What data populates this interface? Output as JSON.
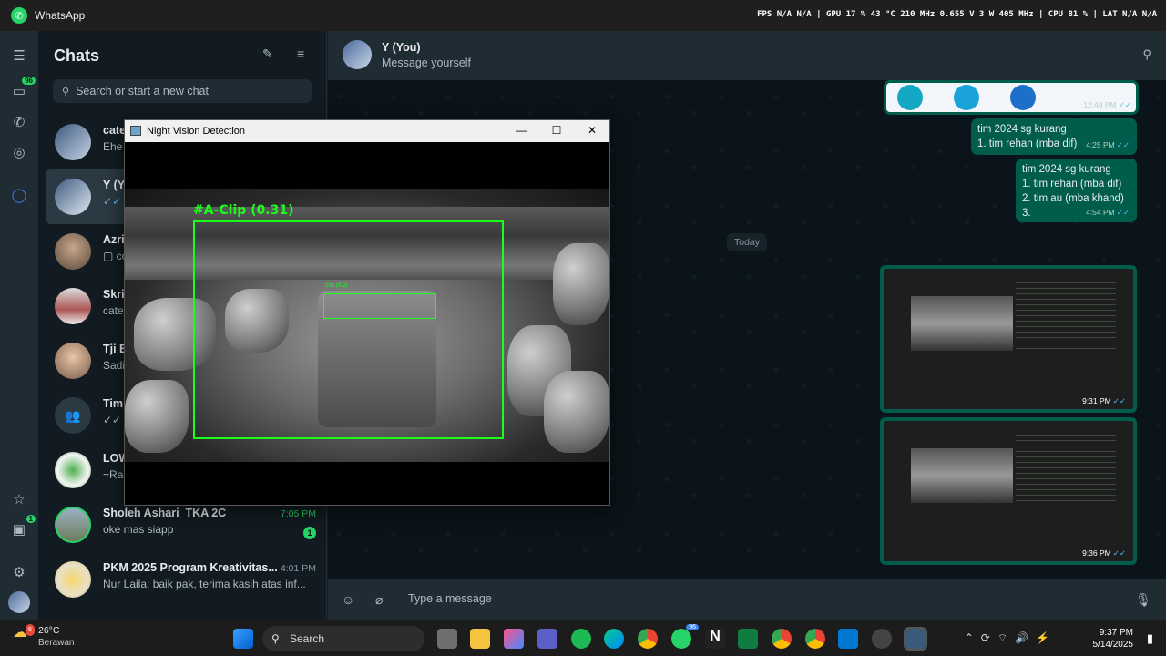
{
  "titlebar": {
    "app": "WhatsApp",
    "perf": "FPS  N/A  N/A  |  GPU  17 %  43 °C  210 MHz  0.655 V  3 W  405 MHz  |  CPU  81 %  |  LAT  N/A  N/A"
  },
  "rail": {
    "chats_badge": "96",
    "updates_badge": "1"
  },
  "chatlist": {
    "title": "Chats",
    "search_placeholder": "Search or start a new chat",
    "chats": [
      {
        "name": "cate",
        "preview": "Ehe",
        "time": "",
        "unread": ""
      },
      {
        "name": "Y (Yo",
        "preview": "✓✓ ",
        "time": "",
        "unread": ""
      },
      {
        "name": "Azril",
        "preview": "▢ co",
        "time": "",
        "unread": ""
      },
      {
        "name": "Skrip",
        "preview": "cate",
        "time": "",
        "unread": ""
      },
      {
        "name": "Tji Bl",
        "preview": "Sadi",
        "time": "",
        "unread": ""
      },
      {
        "name": "Tim",
        "preview": "✓✓",
        "time": "",
        "unread": ""
      },
      {
        "name": "LOW",
        "preview": "~Rad",
        "time": "",
        "unread": ""
      },
      {
        "name": "Sholeh Ashari_TKA 2C",
        "preview": "oke mas siapp",
        "time": "7:05 PM",
        "unread": "1"
      },
      {
        "name": "PKM 2025 Program Kreativitas...",
        "preview": "Nur Laila: baik pak, terima kasih atas inf...",
        "time": "4:01 PM",
        "unread": ""
      }
    ]
  },
  "conversation": {
    "name": "Y (You)",
    "subtitle": "Message yourself",
    "day_chip": "Today",
    "img_time_top": "12:48 PM",
    "msg1": {
      "l1": "tim 2024 sg kurang",
      "l2": "1. tim rehan (mba dif)",
      "time": "4:25 PM"
    },
    "msg2": {
      "l1": "tim 2024 sg kurang",
      "l2": "1. tim rehan (mba dif)",
      "l3": "2. tim au (mba khand)",
      "l4": "3.",
      "time": "4:54 PM"
    },
    "shot1_time": "9:31 PM",
    "shot2_time": "9:36 PM",
    "composer_placeholder": "Type a message"
  },
  "nv_window": {
    "title": "Night Vision Detection",
    "label": "#A-Clip (0.31)",
    "label2": "Clip (0.2)"
  },
  "taskbar": {
    "temp": "26°C",
    "weather": "Berawan",
    "weather_badge": "6",
    "search": "Search",
    "whatsapp_badge": "96",
    "time": "9:37 PM",
    "date": "5/14/2025"
  }
}
